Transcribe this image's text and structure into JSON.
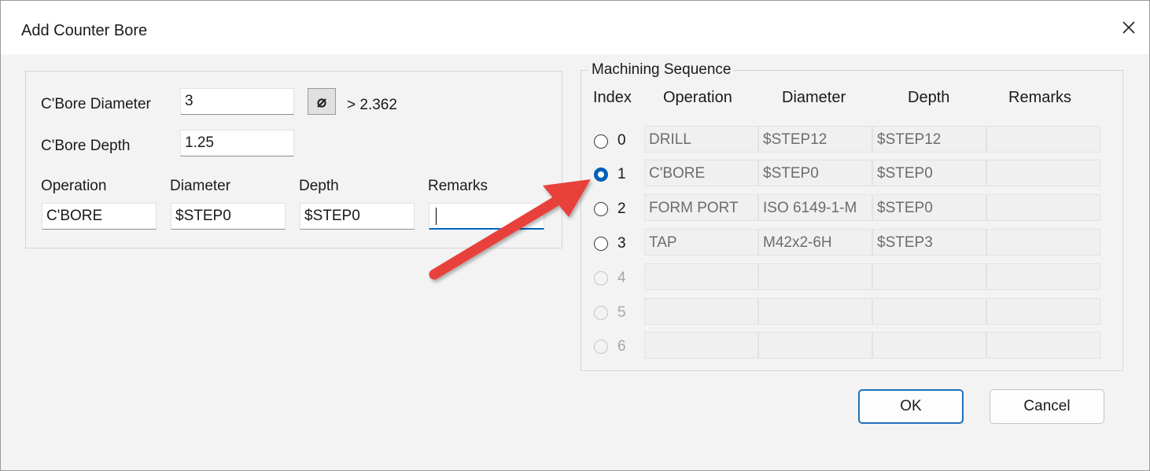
{
  "dialog": {
    "title": "Add Counter Bore",
    "close_glyph": "✕"
  },
  "left": {
    "cbore_diameter_label": "C'Bore Diameter",
    "cbore_diameter_value": "3",
    "diameter_button_glyph": "⌀",
    "min_diameter_text": "> 2.362",
    "cbore_depth_label": "C'Bore Depth",
    "cbore_depth_value": "1.25",
    "operation_label": "Operation",
    "operation_value": "C'BORE",
    "diameter_label": "Diameter",
    "diameter_value": "$STEP0",
    "depth_label": "Depth",
    "depth_value": "$STEP0",
    "remarks_label": "Remarks",
    "remarks_value": ""
  },
  "sequence": {
    "title": "Machining Sequence",
    "headers": [
      "Index",
      "Operation",
      "Diameter",
      "Depth",
      "Remarks"
    ],
    "rows": [
      {
        "index": "0",
        "operation": "DRILL",
        "diameter": "$STEP12",
        "depth": "$STEP12",
        "remarks": "",
        "state": "unchecked"
      },
      {
        "index": "1",
        "operation": "C'BORE",
        "diameter": "$STEP0",
        "depth": "$STEP0",
        "remarks": "",
        "state": "checked"
      },
      {
        "index": "2",
        "operation": "FORM PORT",
        "diameter": "ISO 6149-1-M",
        "depth": "$STEP0",
        "remarks": "",
        "state": "unchecked"
      },
      {
        "index": "3",
        "operation": "TAP",
        "diameter": "M42x2-6H",
        "depth": "$STEP3",
        "remarks": "",
        "state": "unchecked"
      },
      {
        "index": "4",
        "operation": "",
        "diameter": "",
        "depth": "",
        "remarks": "",
        "state": "disabled"
      },
      {
        "index": "5",
        "operation": "",
        "diameter": "",
        "depth": "",
        "remarks": "",
        "state": "disabled"
      },
      {
        "index": "6",
        "operation": "",
        "diameter": "",
        "depth": "",
        "remarks": "",
        "state": "disabled"
      }
    ]
  },
  "buttons": {
    "ok": "OK",
    "cancel": "Cancel"
  },
  "annotation": {
    "arrow_color": "#e8403a"
  },
  "colors": {
    "accent": "#005fb8",
    "focus_underline": "#0067c0"
  }
}
